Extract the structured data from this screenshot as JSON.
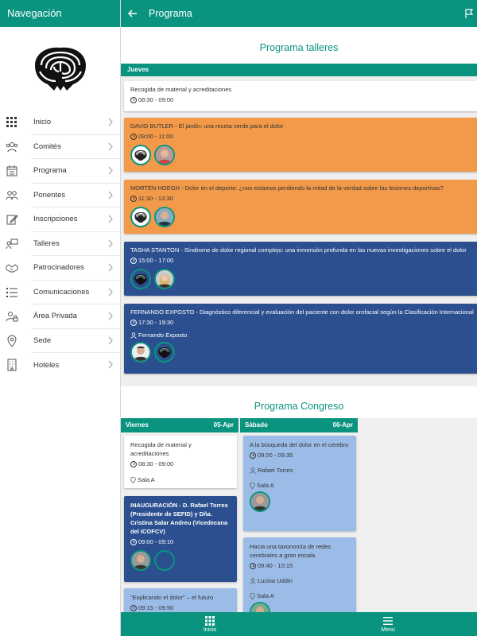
{
  "drawer": {
    "title": "Navegación",
    "items": [
      {
        "label": "Inicio",
        "icon": "grid-icon"
      },
      {
        "label": "Comités",
        "icon": "group-icon"
      },
      {
        "label": "Programa",
        "icon": "calendar-icon"
      },
      {
        "label": "Ponentes",
        "icon": "speakers-icon"
      },
      {
        "label": "Inscripciones",
        "icon": "edit-icon"
      },
      {
        "label": "Talleres",
        "icon": "workshop-icon"
      },
      {
        "label": "Patrocinadores",
        "icon": "handshake-icon"
      },
      {
        "label": "Comunicaciones",
        "icon": "list-icon"
      },
      {
        "label": "Área Privada",
        "icon": "user-lock-icon"
      },
      {
        "label": "Sede",
        "icon": "location-icon"
      },
      {
        "label": "Hoteles",
        "icon": "building-icon"
      }
    ]
  },
  "topbar": {
    "title": "Programa"
  },
  "workshops": {
    "title": "Programa talleres",
    "day": "Jueves",
    "cards": [
      {
        "title": "Recogida de material y acreditaciones",
        "time": "08:30 - 09:00"
      },
      {
        "title": "DAVID BUTLER - El jardín: una receta verde para el dolor",
        "time": "09:00 - 11:00"
      },
      {
        "title": "MORTEN HOEGH - Dolor en el deporte: ¿nos estamos perdiendo la mitad de la verdad sobre las lesiones deportivas?",
        "time": "11:30 - 13:30"
      },
      {
        "title": "TASHA STANTON - Síndrome de dolor regional complejo: una inmersión profunda en las nuevas investigaciones sobre el dolor",
        "time": "15:00 - 17:00"
      },
      {
        "title": "FERNANDO EXPOSTO - Diagnóstico diferencial y evaluación del paciente con dolor orofacial según la Clasificación Internacional",
        "time": "17:30 - 19:30",
        "speaker": "Fernando Exposto"
      }
    ]
  },
  "congress": {
    "title": "Programa Congreso",
    "days": [
      {
        "name": "Viernes",
        "date": "05-Apr"
      },
      {
        "name": "Sábado",
        "date": "06-Apr"
      }
    ],
    "friday": [
      {
        "title": "Recogida de material y acreditaciones",
        "time": "08:30 - 09:00",
        "room": "Sala A"
      },
      {
        "title": "INAUGURACIÓN - D. Rafael Torres (Presidente de SEFID) y Dña. Cristina Salar Andreu (Vicedecana del ICOFCV)",
        "time": "09:00 - 09:10"
      },
      {
        "title": "\"Explicando el dolor\" – el futuro",
        "time": "09:15 - 09:50"
      }
    ],
    "saturday": [
      {
        "title": "A la búsqueda del dolor en el cerebro",
        "time": "09:00 - 09:35",
        "speaker": "Rafael Torres",
        "room": "Sala A"
      },
      {
        "title": "Hacia una taxonomía de redes cerebrales a gran escala",
        "time": "09:40 - 10:15",
        "speaker": "Lucina Uddin",
        "room": "Sala A"
      }
    ]
  },
  "bottombar": {
    "home": "Inicio",
    "menu": "Menu"
  },
  "colors": {
    "primary": "#0a9480",
    "orange": "#f29a4a",
    "navy": "#2b4f8f",
    "light_blue": "#9cbce8"
  }
}
